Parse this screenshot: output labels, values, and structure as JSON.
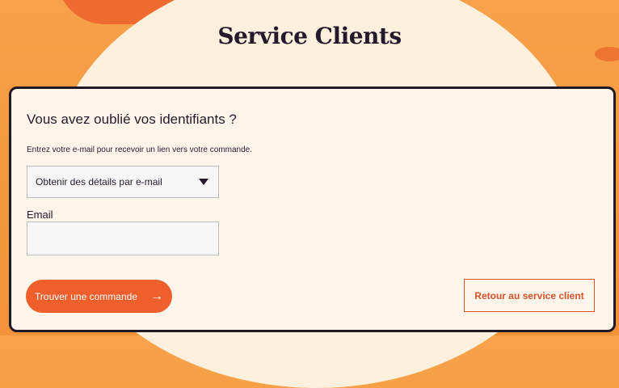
{
  "header": {
    "title": "Service Clients"
  },
  "form": {
    "heading": "Vous avez oublié vos identifiants ?",
    "description": "Entrez votre e-mail pour recevoir un lien vers votre commande.",
    "method_select": {
      "selected": "Obtenir des détails par e-mail"
    },
    "email": {
      "label": "Email",
      "value": "",
      "placeholder": ""
    },
    "submit_label": "Trouver une commande",
    "submit_icon": "arrow-right-icon",
    "back_label": "Retour au service client"
  },
  "colors": {
    "accent": "#ee5f2c",
    "dark": "#241a2c",
    "card_bg": "#fff5ea",
    "page_bg": "#f39a3f"
  }
}
